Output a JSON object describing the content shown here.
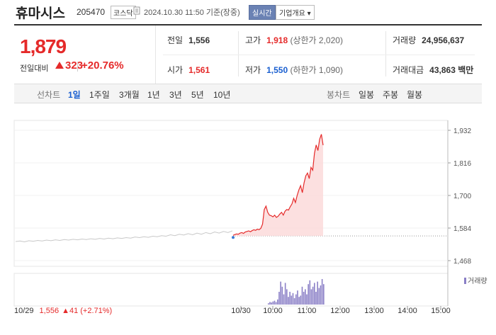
{
  "header": {
    "title": "휴마시스",
    "code": "205470",
    "market": "코스닥",
    "timestamp": "2024.10.30 11:50 기준(장중)",
    "realtime_label": "실시간",
    "company_label": "기업개요 ▾"
  },
  "price": {
    "current": "1,879",
    "diff_label": "전일대비",
    "diff": "323",
    "pct": "+20.76%"
  },
  "stats": {
    "prev_label": "전일",
    "prev": "1,556",
    "high_label": "고가",
    "high": "1,918",
    "high_limit": "(상한가 2,020)",
    "volume_label": "거래량",
    "volume": "24,956,637",
    "open_label": "시가",
    "open": "1,561",
    "low_label": "저가",
    "low": "1,550",
    "low_limit": "(하한가 1,090)",
    "amount_label": "거래대금",
    "amount": "43,863",
    "amount_unit": "백만"
  },
  "tabs": {
    "line_label": "선차트",
    "periods": [
      "1일",
      "1주일",
      "3개월",
      "1년",
      "3년",
      "5년",
      "10년"
    ],
    "candle_label": "봉차트",
    "candle_periods": [
      "일봉",
      "주봉",
      "월봉"
    ]
  },
  "chart_data": {
    "type": "line",
    "y_ticks": [
      "1,932",
      "1,816",
      "1,700",
      "1,584",
      "1,468"
    ],
    "ylim": [
      1468,
      1932
    ],
    "x_ticks": [
      "10/30",
      "10:00",
      "11:00",
      "12:00",
      "13:00",
      "14:00",
      "15:00"
    ],
    "prev_day_label": "10/29",
    "prev_day_close": "1,556",
    "prev_day_change": "▲41 (+2.71%)",
    "volume_legend": "거래량",
    "baseline": 1556,
    "prev_day_series": [
      1536,
      1538,
      1535,
      1539,
      1537,
      1540,
      1538,
      1541,
      1539,
      1542,
      1540,
      1543,
      1541,
      1544,
      1542,
      1545,
      1543,
      1546,
      1544,
      1547,
      1545,
      1548,
      1546,
      1549,
      1547,
      1550,
      1548,
      1552,
      1550,
      1553,
      1551,
      1555,
      1553,
      1557,
      1555,
      1560,
      1557,
      1562,
      1559,
      1564,
      1560,
      1566,
      1562,
      1568,
      1564,
      1570,
      1566,
      1572,
      1568,
      1574
    ],
    "today_series": [
      1558,
      1561,
      1563,
      1562,
      1566,
      1568,
      1565,
      1570,
      1572,
      1574,
      1571,
      1575,
      1578,
      1576,
      1580,
      1578,
      1583,
      1598,
      1650,
      1662,
      1640,
      1630,
      1628,
      1624,
      1630,
      1622,
      1626,
      1634,
      1640,
      1630,
      1644,
      1650,
      1648,
      1660,
      1670,
      1690,
      1675,
      1700,
      1720,
      1735,
      1710,
      1745,
      1770,
      1780,
      1760,
      1800,
      1790,
      1850,
      1880,
      1860,
      1900,
      1918,
      1879
    ],
    "volumes": [
      0.05,
      0.1,
      0.08,
      0.12,
      0.15,
      0.1,
      0.2,
      0.5,
      0.9,
      0.7,
      0.4,
      0.85,
      0.6,
      0.3,
      0.5,
      0.35,
      0.45,
      0.25,
      0.4,
      0.55,
      0.3,
      0.35,
      0.7,
      0.5,
      0.6,
      0.4,
      0.8,
      0.95,
      0.6,
      0.7,
      0.85,
      0.5,
      0.9,
      0.65,
      0.75,
      1.0,
      0.8
    ]
  }
}
